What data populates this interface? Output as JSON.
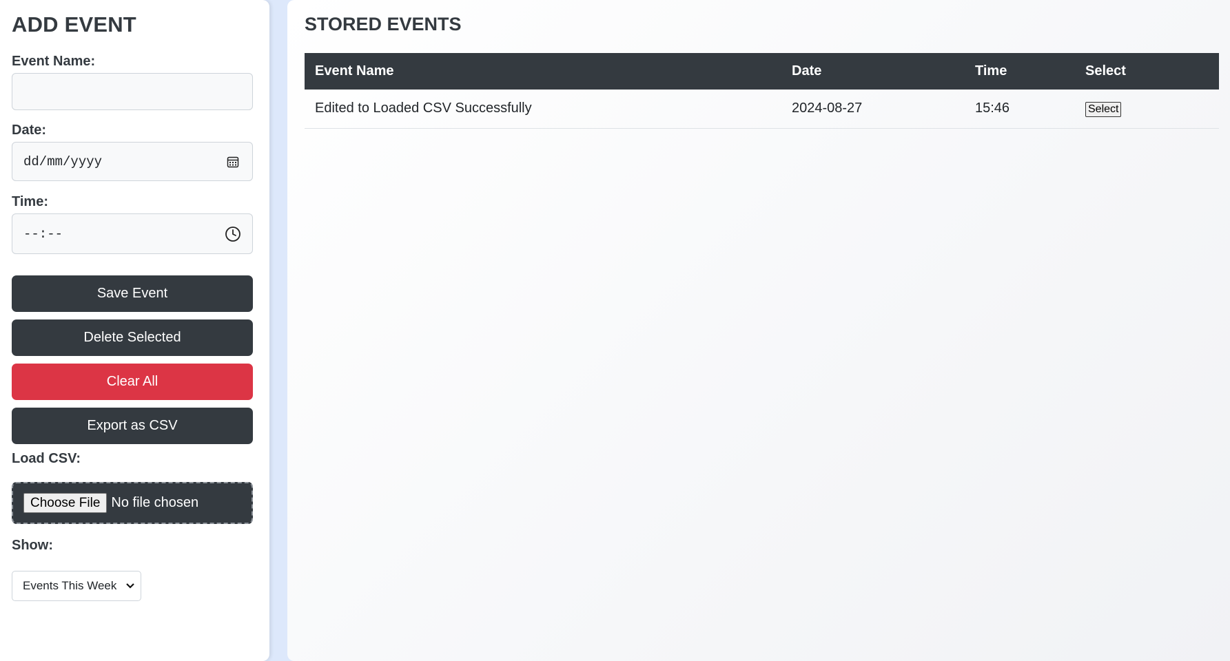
{
  "add_event": {
    "title": "ADD EVENT",
    "event_name_label": "Event Name:",
    "event_name_value": "",
    "date_label": "Date:",
    "date_placeholder": "dd/mm/yyyy",
    "date_icon": "calendar-icon",
    "time_label": "Time:",
    "time_placeholder": "--:--",
    "time_icon": "clock-icon",
    "buttons": {
      "save": "Save Event",
      "delete": "Delete Selected",
      "clear": "Clear All",
      "export": "Export as CSV"
    },
    "load_csv_label": "Load CSV:",
    "choose_file": "Choose File",
    "file_status": "No file chosen",
    "show_label": "Show:",
    "show_selected": "Events This Week"
  },
  "stored_events": {
    "title": "STORED EVENTS",
    "columns": [
      "Event Name",
      "Date",
      "Time",
      "Select"
    ],
    "rows": [
      {
        "event_name": "Edited to Loaded CSV Successfully",
        "date": "2024-08-27",
        "time": "15:46",
        "select_label": "Select"
      }
    ]
  },
  "colors": {
    "dark": "#343a40",
    "danger": "#dc3545",
    "background": "#dde8fb"
  }
}
